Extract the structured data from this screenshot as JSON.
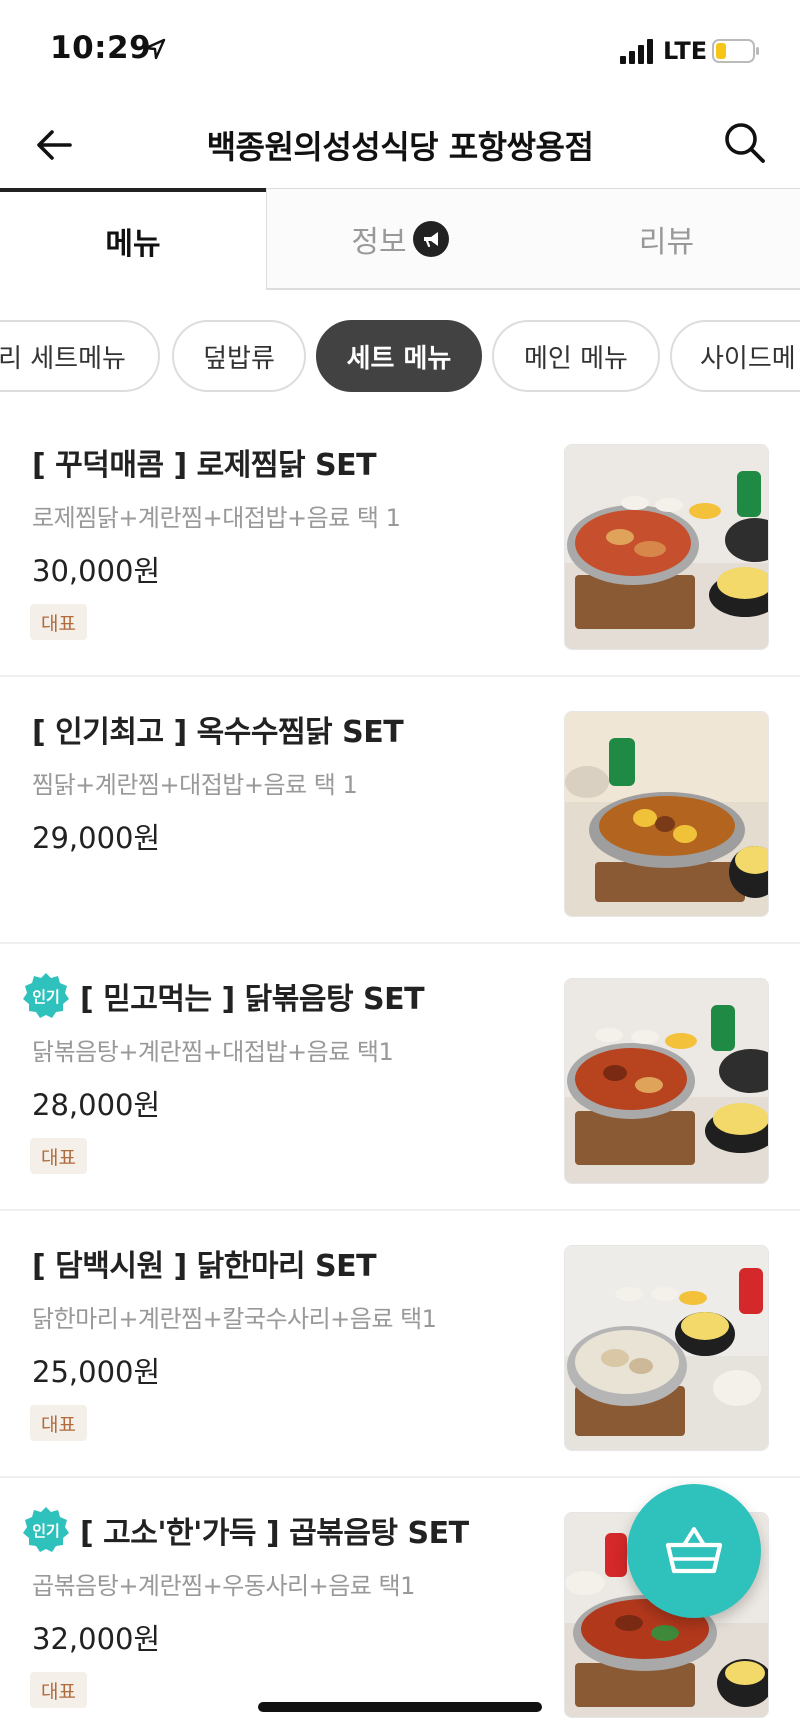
{
  "status": {
    "time": "10:29",
    "network": "LTE"
  },
  "header": {
    "title": "백종원의성성식당 포항쌍용점"
  },
  "tabs": [
    {
      "label": "메뉴"
    },
    {
      "label": "정보"
    },
    {
      "label": "리뷰"
    }
  ],
  "categories": [
    "리 세트메뉴",
    "덮밥류",
    "세트 메뉴",
    "메인 메뉴",
    "사이드메"
  ],
  "selected_category": "세트 메뉴",
  "menu": [
    {
      "name": "[ 꾸덕매콤 ] 로제찜닭 SET",
      "desc": "로제찜닭+계란찜+대접밥+음료 택 1",
      "price": "30,000원",
      "badge": "대표",
      "popular": false
    },
    {
      "name": "[ 인기최고 ] 옥수수찜닭 SET",
      "desc": "찜닭+계란찜+대접밥+음료 택 1",
      "price": "29,000원",
      "badge": "",
      "popular": false
    },
    {
      "name": "[ 믿고먹는 ] 닭볶음탕 SET",
      "desc": "닭볶음탕+계란찜+대접밥+음료 택1",
      "price": "28,000원",
      "badge": "대표",
      "popular": true,
      "popular_label": "인기"
    },
    {
      "name": "[ 담백시원 ] 닭한마리 SET",
      "desc": "닭한마리+계란찜+칼국수사리+음료 택1",
      "price": "25,000원",
      "badge": "대표",
      "popular": false
    },
    {
      "name": "[ 고소'한'가득 ] 곱볶음탕 SET",
      "desc": "곱볶음탕+계란찜+우동사리+음료 택1",
      "price": "32,000원",
      "badge": "대표",
      "popular": true,
      "popular_label": "인기"
    }
  ],
  "colors": {
    "accent": "#2fc1bc",
    "active_chip": "#424242",
    "badge_bg": "#f4efe8",
    "badge_text": "#b06a3b"
  },
  "icons": {
    "back": "arrow-left-icon",
    "search": "search-icon",
    "info": "megaphone-icon",
    "cart": "basket-icon"
  }
}
